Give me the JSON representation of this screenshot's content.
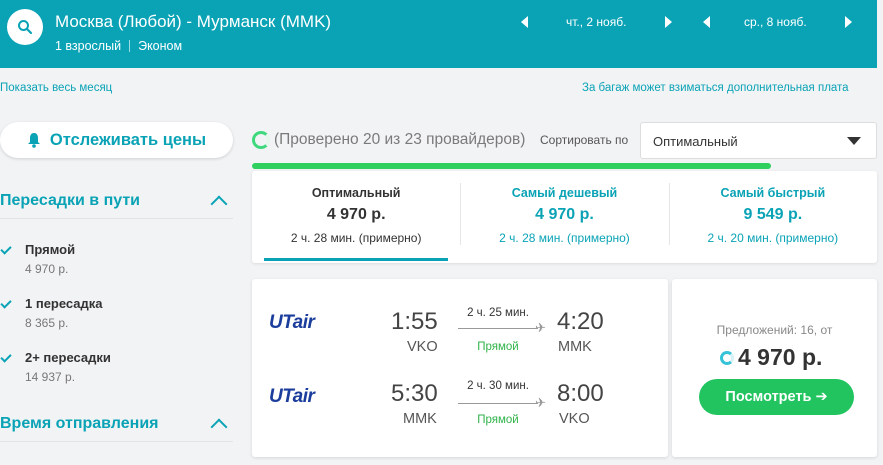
{
  "header": {
    "route": "Москва (Любой) - Мурманск (MMK)",
    "passengers": "1 взрослый",
    "cabin": "Эконом",
    "depart_date": "чт., 2 нояб.",
    "return_date": "ср., 8 нояб."
  },
  "links": {
    "show_month": "Показать весь месяц",
    "baggage_note": "За багаж может взиматься дополнительная плата"
  },
  "sidebar": {
    "track_prices": "Отслеживать цены",
    "stops_title": "Пересадки в пути",
    "stops": [
      {
        "label": "Прямой",
        "price": "4 970 р."
      },
      {
        "label": "1 пересадка",
        "price": "8 365 р."
      },
      {
        "label": "2+ пересадки",
        "price": "14 937 р."
      }
    ],
    "departure_title": "Время отправления"
  },
  "progress": {
    "checked_text": "(Проверено 20 из 23 провайдеров)",
    "fraction": 0.83
  },
  "sort": {
    "label": "Сортировать по",
    "value": "Оптимальный"
  },
  "tabs": [
    {
      "name": "Оптимальный",
      "price": "4 970 р.",
      "time": "2 ч. 28 мин. (примерно)"
    },
    {
      "name": "Самый дешевый",
      "price": "4 970 р.",
      "time": "2 ч. 28 мин. (примерно)"
    },
    {
      "name": "Самый быстрый",
      "price": "9 549 р.",
      "time": "2 ч. 20 мин. (примерно)"
    }
  ],
  "ticket": {
    "legs": [
      {
        "airline": "UTair",
        "dep_time": "1:55",
        "dep_code": "VKO",
        "duration": "2 ч. 25 мин.",
        "type": "Прямой",
        "arr_time": "4:20",
        "arr_code": "MMK"
      },
      {
        "airline": "UTair",
        "dep_time": "5:30",
        "dep_code": "MMK",
        "duration": "2 ч. 30 мин.",
        "type": "Прямой",
        "arr_time": "8:00",
        "arr_code": "VKO"
      }
    ],
    "offers": "Предложений: 16, от",
    "price": "4 970 р.",
    "view_button": "Посмотреть ➔"
  },
  "colors": {
    "brand": "#0aa3b6",
    "green": "#21c45f",
    "airline": "#1b3d9c"
  }
}
